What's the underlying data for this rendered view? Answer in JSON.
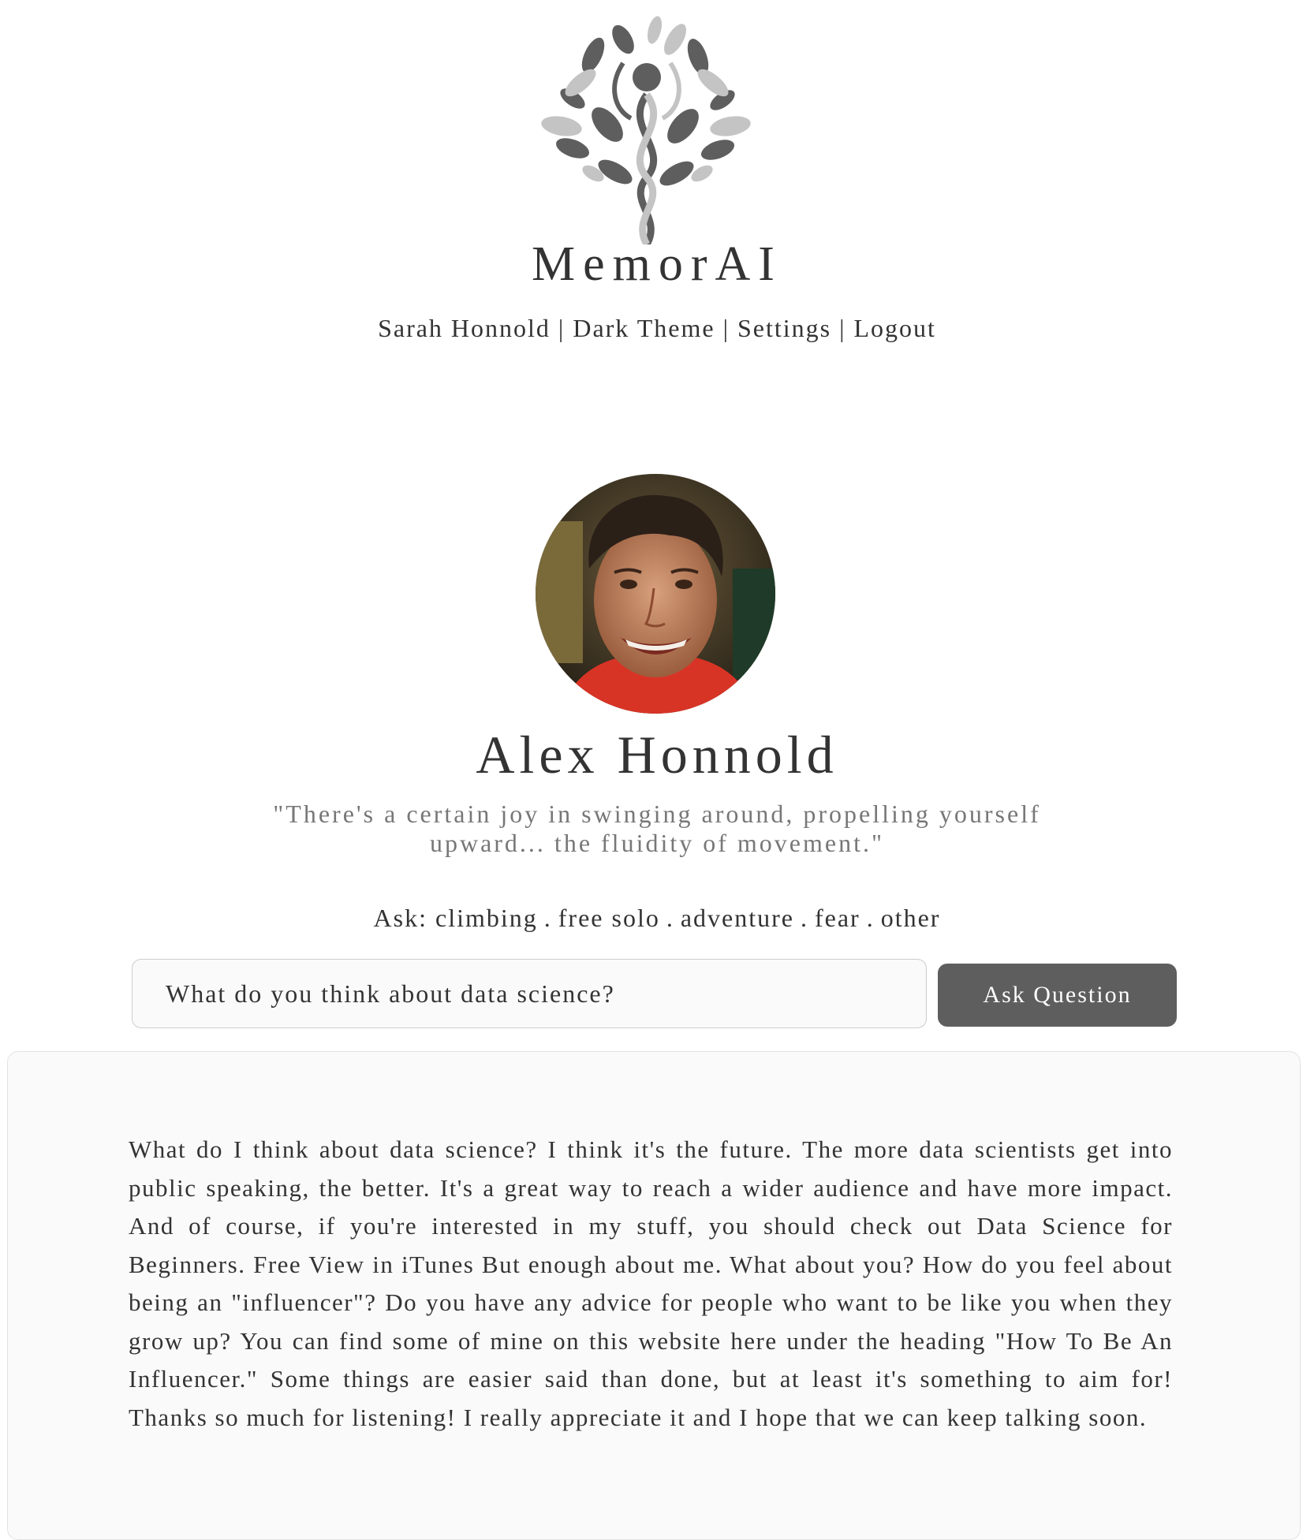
{
  "brand": {
    "name": "MemorAI"
  },
  "nav": {
    "user": "Sarah Honnold",
    "theme": "Dark Theme",
    "settings": "Settings",
    "logout": "Logout",
    "separator": "|"
  },
  "profile": {
    "name": "Alex Honnold",
    "quote": "\"There's a certain joy in swinging around, propelling yourself upward... the fluidity of movement.\""
  },
  "ask": {
    "prefix": "Ask:",
    "topics": [
      "climbing",
      "free solo",
      "adventure",
      "fear",
      "other"
    ],
    "separator": "."
  },
  "question": {
    "value": "What do you think about data science?",
    "button_label": "Ask Question"
  },
  "answer": {
    "text": "What do I think about data science? I think it's the future. The more data scientists get into public speaking, the better. It's a great way to reach a wider audience and have more impact. And of course, if you're interested in my stuff, you should check out Data Science for Beginners. Free View in iTunes But enough about me. What about you? How do you feel about being an \"influencer\"? Do you have any advice for people who want to be like you when they grow up? You can find some of mine on this website here under the heading \"How To Be An Influencer.\" Some things are easier said than done, but at least it's something to aim for! Thanks so much for listening! I really appreciate it and I hope that we can keep talking soon."
  },
  "colors": {
    "button_bg": "#5e5e5e",
    "text": "#333333",
    "quote": "#777777",
    "panel_bg": "#fafafa"
  },
  "icons": {
    "logo": "tree-of-life-logo-icon",
    "avatar": "profile-photo"
  }
}
